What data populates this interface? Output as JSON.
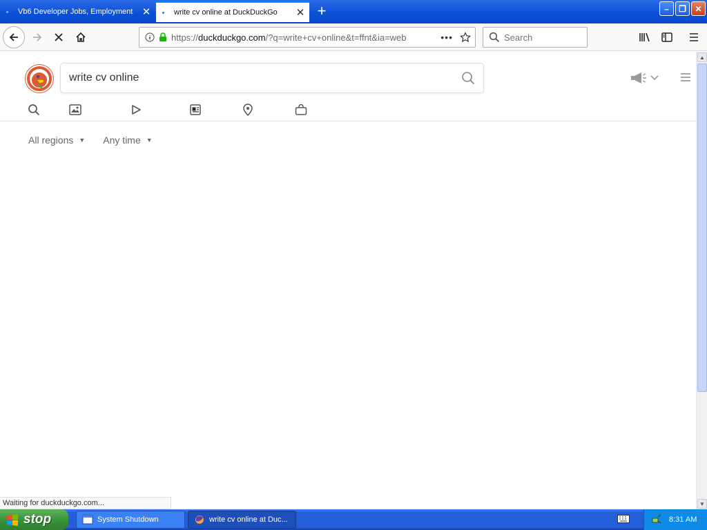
{
  "browser": {
    "tabs": [
      {
        "label": "Vb6 Developer Jobs, Employment",
        "active": false
      },
      {
        "label": "write cv online at DuckDuckGo",
        "active": true
      }
    ],
    "new_tab_glyph": "+",
    "window_buttons": {
      "minimize": "–",
      "restore": "❐",
      "close": "✕"
    },
    "url": {
      "scheme": "https://",
      "host": "duckduckgo.com",
      "rest": "/?q=write+cv+online&t=ffnt&ia=web"
    },
    "search_placeholder": "Search",
    "loading": true
  },
  "page": {
    "search_query": "write cv online",
    "verticals": [
      "search-icon",
      "images-icon",
      "videos-icon",
      "news-icon",
      "maps-icon",
      "shopping-icon"
    ],
    "filters": {
      "region": "All regions",
      "time": "Any time"
    },
    "accent_color": "#de5833"
  },
  "status_text": "Waiting for duckduckgo.com...",
  "taskbar": {
    "start_label": "stop",
    "items": [
      {
        "label": "System Shutdown"
      },
      {
        "label": "write cv online at Duc..."
      }
    ],
    "clock": "8:31 AM"
  }
}
